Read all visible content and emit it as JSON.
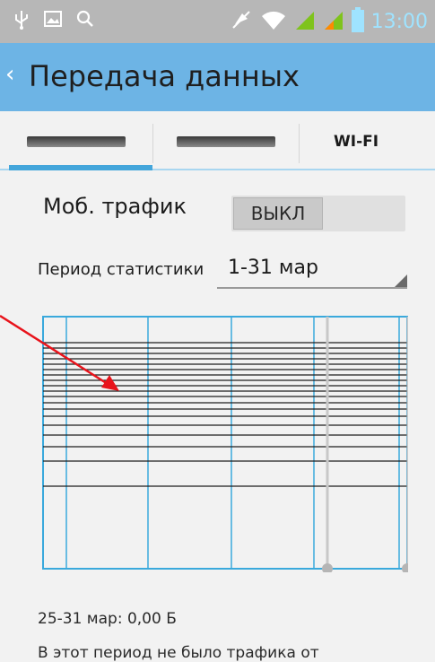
{
  "status_bar": {
    "icons_left": [
      "usb-icon",
      "image-icon",
      "search-icon"
    ],
    "icons_right": [
      "mute-icon",
      "wifi-icon",
      "signal-icon",
      "signal-icon-2",
      "battery-icon"
    ],
    "time": "13:00",
    "colors": {
      "background": "#b7b7b7",
      "time": "#9fe3ff",
      "signal": "#7fc31c"
    }
  },
  "action_bar": {
    "title": "Передача данных",
    "color": "#6db4e5"
  },
  "tabs": {
    "items": [
      {
        "label": "",
        "blurred": true,
        "selected": true
      },
      {
        "label": "",
        "blurred": true,
        "selected": false
      },
      {
        "label": "WI-FI",
        "blurred": false,
        "selected": false
      }
    ],
    "indicator_color": "#44a6db"
  },
  "mobile_traffic": {
    "label": "Моб. трафик",
    "toggle_label": "ВЫКЛ",
    "enabled": false
  },
  "period": {
    "label": "Период статистики",
    "value": "1-31 мар"
  },
  "summary": {
    "text": "25-31 мар: 0,00 Б"
  },
  "notice": {
    "text": "В этот период не было трафика от"
  },
  "annotation": {
    "arrow_color": "#e8131b"
  }
}
